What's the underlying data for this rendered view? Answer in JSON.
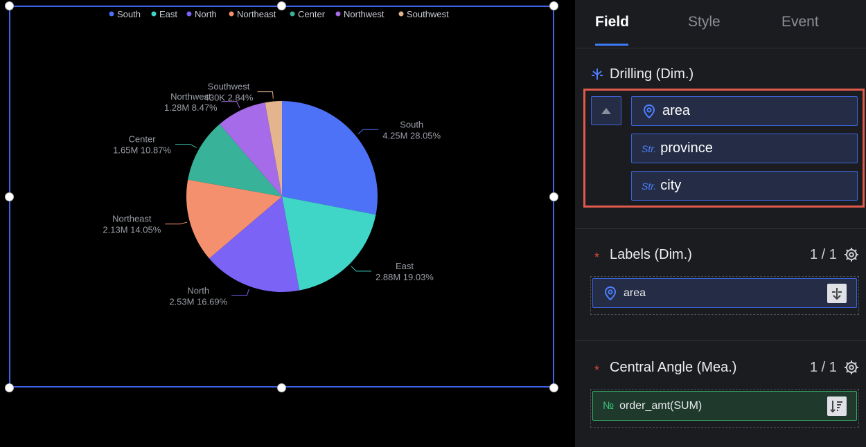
{
  "panel": {
    "tabs": [
      {
        "label": "Field",
        "active": true
      },
      {
        "label": "Style",
        "active": false
      },
      {
        "label": "Event",
        "active": false
      }
    ],
    "drilling": {
      "title": "Drilling (Dim.)",
      "fields": [
        {
          "label": "area",
          "type_icon": "location-pin-icon"
        },
        {
          "label": "province",
          "type_tag": "Str."
        },
        {
          "label": "city",
          "type_tag": "Str."
        }
      ],
      "collapse_icon": "triangle-up-icon"
    },
    "labels": {
      "title": "Labels (Dim.)",
      "required_mark": "*",
      "count": "1 / 1",
      "field": {
        "label": "area",
        "type_icon": "location-pin-icon",
        "action_icon": "drill-icon"
      }
    },
    "central_angle": {
      "title": "Central Angle (Mea.)",
      "required_mark": "*",
      "count": "1 / 1",
      "field": {
        "label": "order_amt(SUM)",
        "type_tag": "№",
        "action_icon": "sort-icon"
      }
    },
    "accent_color": "#3d7af5",
    "highlight_color": "#e05a4b"
  },
  "chart_data": {
    "type": "pie",
    "categories": [
      "South",
      "East",
      "North",
      "Northeast",
      "Center",
      "Northwest",
      "Southwest"
    ],
    "values": [
      28.05,
      19.03,
      16.69,
      14.05,
      10.87,
      8.47,
      2.84
    ],
    "value_labels": [
      "4.25M",
      "2.88M",
      "2.53M",
      "2.13M",
      "1.65M",
      "1.28M",
      "430K"
    ],
    "percent_labels": [
      "28.05%",
      "19.03%",
      "16.69%",
      "14.05%",
      "10.87%",
      "8.47%",
      "2.84%"
    ],
    "colors": [
      "#4e72f7",
      "#3fd6c7",
      "#7b63f5",
      "#f5906f",
      "#39b29a",
      "#a56be8",
      "#e3b48e"
    ],
    "legend": "top-center"
  }
}
